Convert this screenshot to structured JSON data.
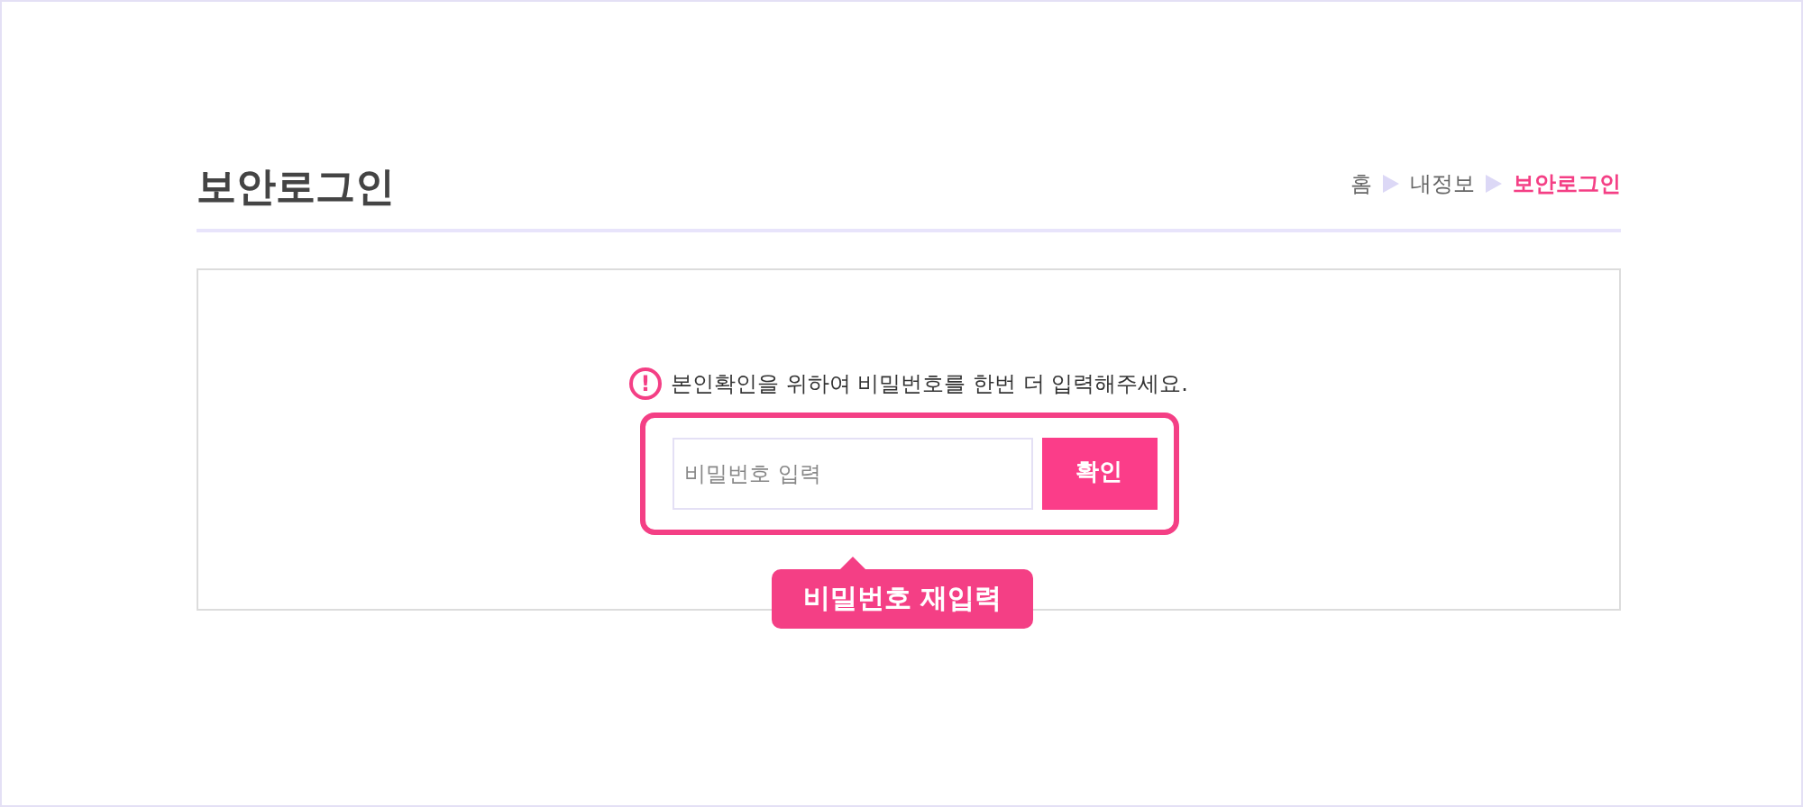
{
  "page_title": "보안로그인",
  "breadcrumb": [
    {
      "label": "홈",
      "selected": false
    },
    {
      "label": "내정보",
      "selected": false
    },
    {
      "label": "보안로그인",
      "selected": true
    }
  ],
  "notice": {
    "icon": "!",
    "text": "본인확인을 위하여 비밀번호를 한번 더 입력해주세요."
  },
  "password_field": {
    "placeholder": "비밀번호 입력"
  },
  "confirm_button": "확인",
  "callout": "비밀번호 재입력"
}
